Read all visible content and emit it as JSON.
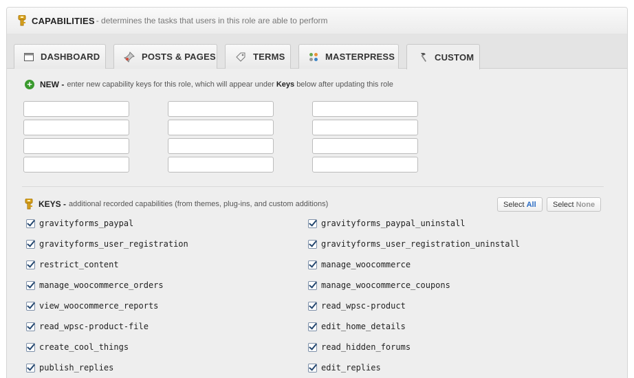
{
  "header": {
    "title": "CAPABILITIES",
    "description": "- determines the tasks that users in this role are able to perform"
  },
  "tabs": [
    {
      "label": "DASHBOARD",
      "icon": "window-icon"
    },
    {
      "label": "POSTS & PAGES",
      "icon": "pin-icon"
    },
    {
      "label": "TERMS",
      "icon": "tag-icon"
    },
    {
      "label": "MASTERPRESS",
      "icon": "dots-icon"
    },
    {
      "label": "CUSTOM",
      "icon": "hammer-icon",
      "active": true
    }
  ],
  "new_section": {
    "label": "NEW -",
    "desc_before": "enter new capability keys for this role, which will appear under",
    "desc_bold": "Keys",
    "desc_after": "below after updating this role"
  },
  "keys_section": {
    "label": "KEYS -",
    "desc": "additional recorded capabilities (from themes, plug-ins, and custom additions)",
    "select_all_prefix": "Select",
    "select_all_word": "All",
    "select_none_prefix": "Select",
    "select_none_word": "None"
  },
  "capabilities": [
    {
      "name": "gravityforms_paypal",
      "checked": true
    },
    {
      "name": "gravityforms_paypal_uninstall",
      "checked": true
    },
    {
      "name": "gravityforms_user_registration",
      "checked": true
    },
    {
      "name": "gravityforms_user_registration_uninstall",
      "checked": true
    },
    {
      "name": "restrict_content",
      "checked": true
    },
    {
      "name": "manage_woocommerce",
      "checked": true
    },
    {
      "name": "manage_woocommerce_orders",
      "checked": true
    },
    {
      "name": "manage_woocommerce_coupons",
      "checked": true
    },
    {
      "name": "view_woocommerce_reports",
      "checked": true
    },
    {
      "name": "read_wpsc-product",
      "checked": true
    },
    {
      "name": "read_wpsc-product-file",
      "checked": true
    },
    {
      "name": "edit_home_details",
      "checked": true
    },
    {
      "name": "create_cool_things",
      "checked": true
    },
    {
      "name": "read_hidden_forums",
      "checked": true
    },
    {
      "name": "publish_replies",
      "checked": true
    },
    {
      "name": "edit_replies",
      "checked": true
    }
  ]
}
